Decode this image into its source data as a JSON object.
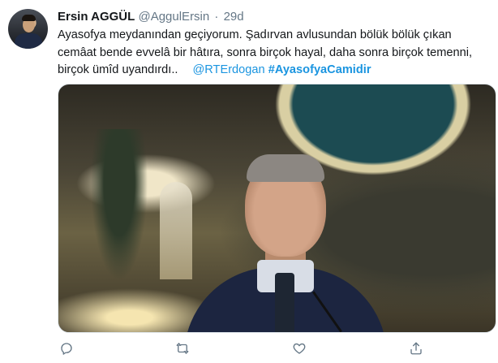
{
  "tweet": {
    "display_name": "Ersin AGGÜL",
    "handle": "@AggulErsin",
    "separator": "·",
    "time": "29d",
    "text_main": "Ayasofya meydanından geçiyorum. Şadırvan avlusundan bölük bölük çıkan cemâat bende evvelâ bir hâtıra, sonra birçok hayal, daha sonra birçok temenni, birçok ümîd uyandırdı..",
    "mention": "@RTErdogan",
    "hashtag": "#AyasofyaCamidir"
  },
  "actions": {
    "reply_icon": "reply-icon",
    "retweet_icon": "retweet-icon",
    "like_icon": "heart-icon",
    "share_icon": "share-icon"
  },
  "colors": {
    "link": "#1b95e0",
    "secondary_text": "#657786",
    "primary_text": "#14171a"
  }
}
